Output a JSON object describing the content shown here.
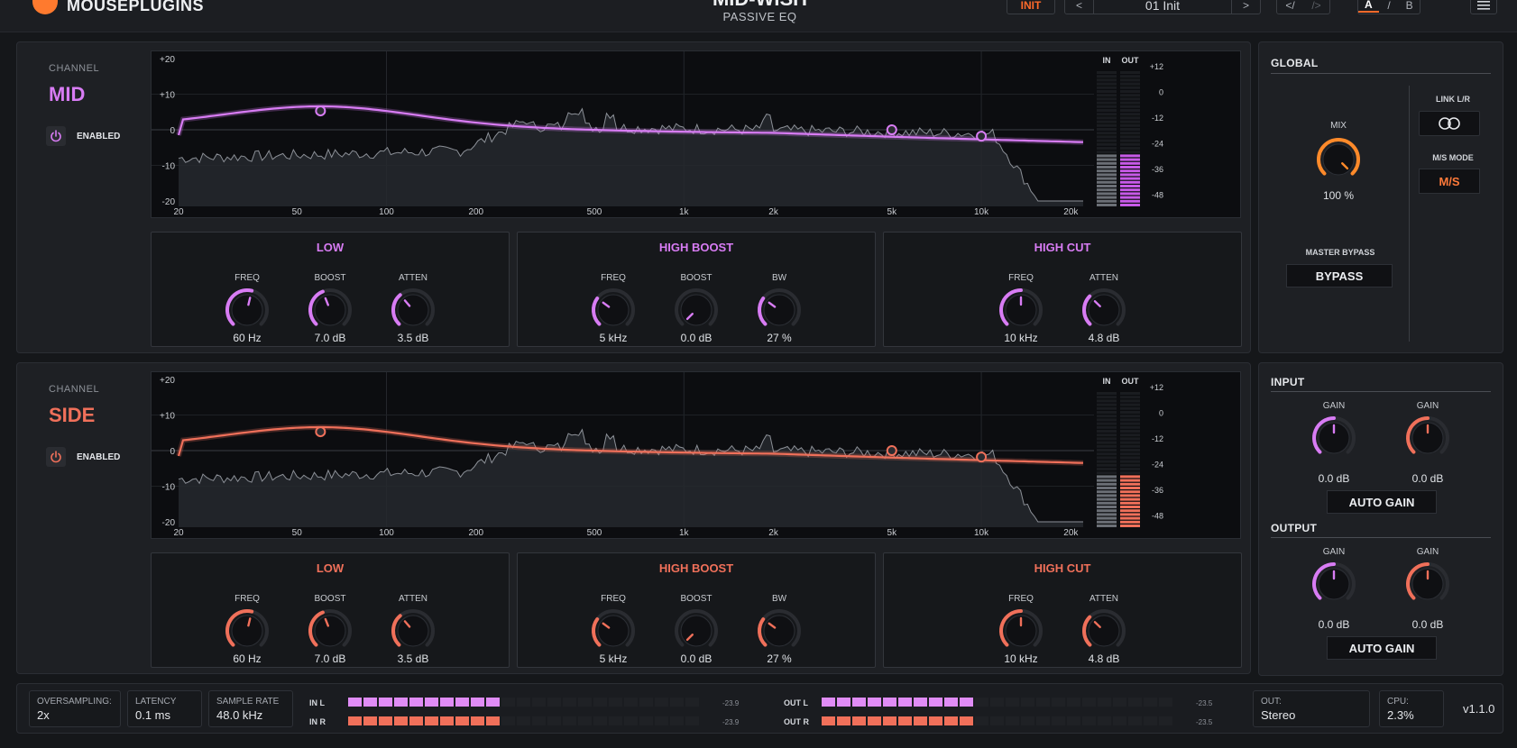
{
  "header": {
    "brand": "MOUSEPLUGINS",
    "product": "MID-WISH",
    "subtitle": "PASSIVE EQ",
    "init_label": "INIT",
    "preset_prev": "<",
    "preset_name": "01  Init",
    "preset_next": ">",
    "undo": "</",
    "redo": "/>",
    "a": "A",
    "slash": "/",
    "b": "B",
    "accent": "#ff6a2a"
  },
  "channels": [
    {
      "label": "CHANNEL",
      "name": "MID",
      "enabled": "ENABLED",
      "color": "#d87cf4",
      "fill": "#c85ae8",
      "bands": [
        {
          "title": "LOW",
          "knobs": [
            {
              "label": "FREQ",
              "value": "60 Hz"
            },
            {
              "label": "BOOST",
              "value": "7.0 dB"
            },
            {
              "label": "ATTEN",
              "value": "3.5 dB"
            }
          ]
        },
        {
          "title": "HIGH BOOST",
          "knobs": [
            {
              "label": "FREQ",
              "value": "5 kHz"
            },
            {
              "label": "BOOST",
              "value": "0.0 dB"
            },
            {
              "label": "BW",
              "value": "27 %"
            }
          ]
        },
        {
          "title": "HIGH CUT",
          "knobs": [
            {
              "label": "FREQ",
              "value": "10 kHz"
            },
            {
              "label": "ATTEN",
              "value": "4.8 dB"
            }
          ]
        }
      ]
    },
    {
      "label": "CHANNEL",
      "name": "SIDE",
      "enabled": "ENABLED",
      "color": "#f0705a",
      "fill": "#f0705a",
      "bands": [
        {
          "title": "LOW",
          "knobs": [
            {
              "label": "FREQ",
              "value": "60 Hz"
            },
            {
              "label": "BOOST",
              "value": "7.0 dB"
            },
            {
              "label": "ATTEN",
              "value": "3.5 dB"
            }
          ]
        },
        {
          "title": "HIGH BOOST",
          "knobs": [
            {
              "label": "FREQ",
              "value": "5 kHz"
            },
            {
              "label": "BOOST",
              "value": "0.0 dB"
            },
            {
              "label": "BW",
              "value": "27 %"
            }
          ]
        },
        {
          "title": "HIGH CUT",
          "knobs": [
            {
              "label": "FREQ",
              "value": "10 kHz"
            },
            {
              "label": "ATTEN",
              "value": "4.8 dB"
            }
          ]
        }
      ]
    }
  ],
  "graph": {
    "db_labels": [
      "+20",
      "+10",
      "0",
      "-10",
      "-20"
    ],
    "freq_labels": [
      "20",
      "50",
      "100",
      "200",
      "500",
      "1k",
      "2k",
      "5k",
      "10k",
      "20k"
    ],
    "meter_in": "IN",
    "meter_out": "OUT",
    "meter_scale": [
      "+12",
      "0",
      "-12",
      "-24",
      "-36",
      "-48"
    ]
  },
  "global": {
    "title": "GLOBAL",
    "mix_label": "MIX",
    "mix_value": "100 %",
    "link_label": "LINK L/R",
    "ms_mode_label": "M/S MODE",
    "ms_mode_value": "M/S",
    "master_bypass_label": "MASTER BYPASS",
    "bypass_button": "BYPASS"
  },
  "io": {
    "input_title": "INPUT",
    "output_title": "OUTPUT",
    "gain_label": "GAIN",
    "gain_value": "0.0 dB",
    "auto_gain": "AUTO GAIN"
  },
  "status": {
    "oversampling_label": "OVERSAMPLING:",
    "oversampling_value": "2x",
    "latency_label": "LATENCY",
    "latency_value": "0.1 ms",
    "sample_rate_label": "SAMPLE RATE",
    "sample_rate_value": "48.0 kHz",
    "in_l": "IN L",
    "in_r": "IN R",
    "in_level": "-23.9",
    "out_l": "OUT L",
    "out_r": "OUT R",
    "out_level": "-23.5",
    "out_label": "OUT:",
    "out_value": "Stereo",
    "cpu_label": "CPU:",
    "cpu_value": "2.3%",
    "version": "v1.1.0"
  }
}
